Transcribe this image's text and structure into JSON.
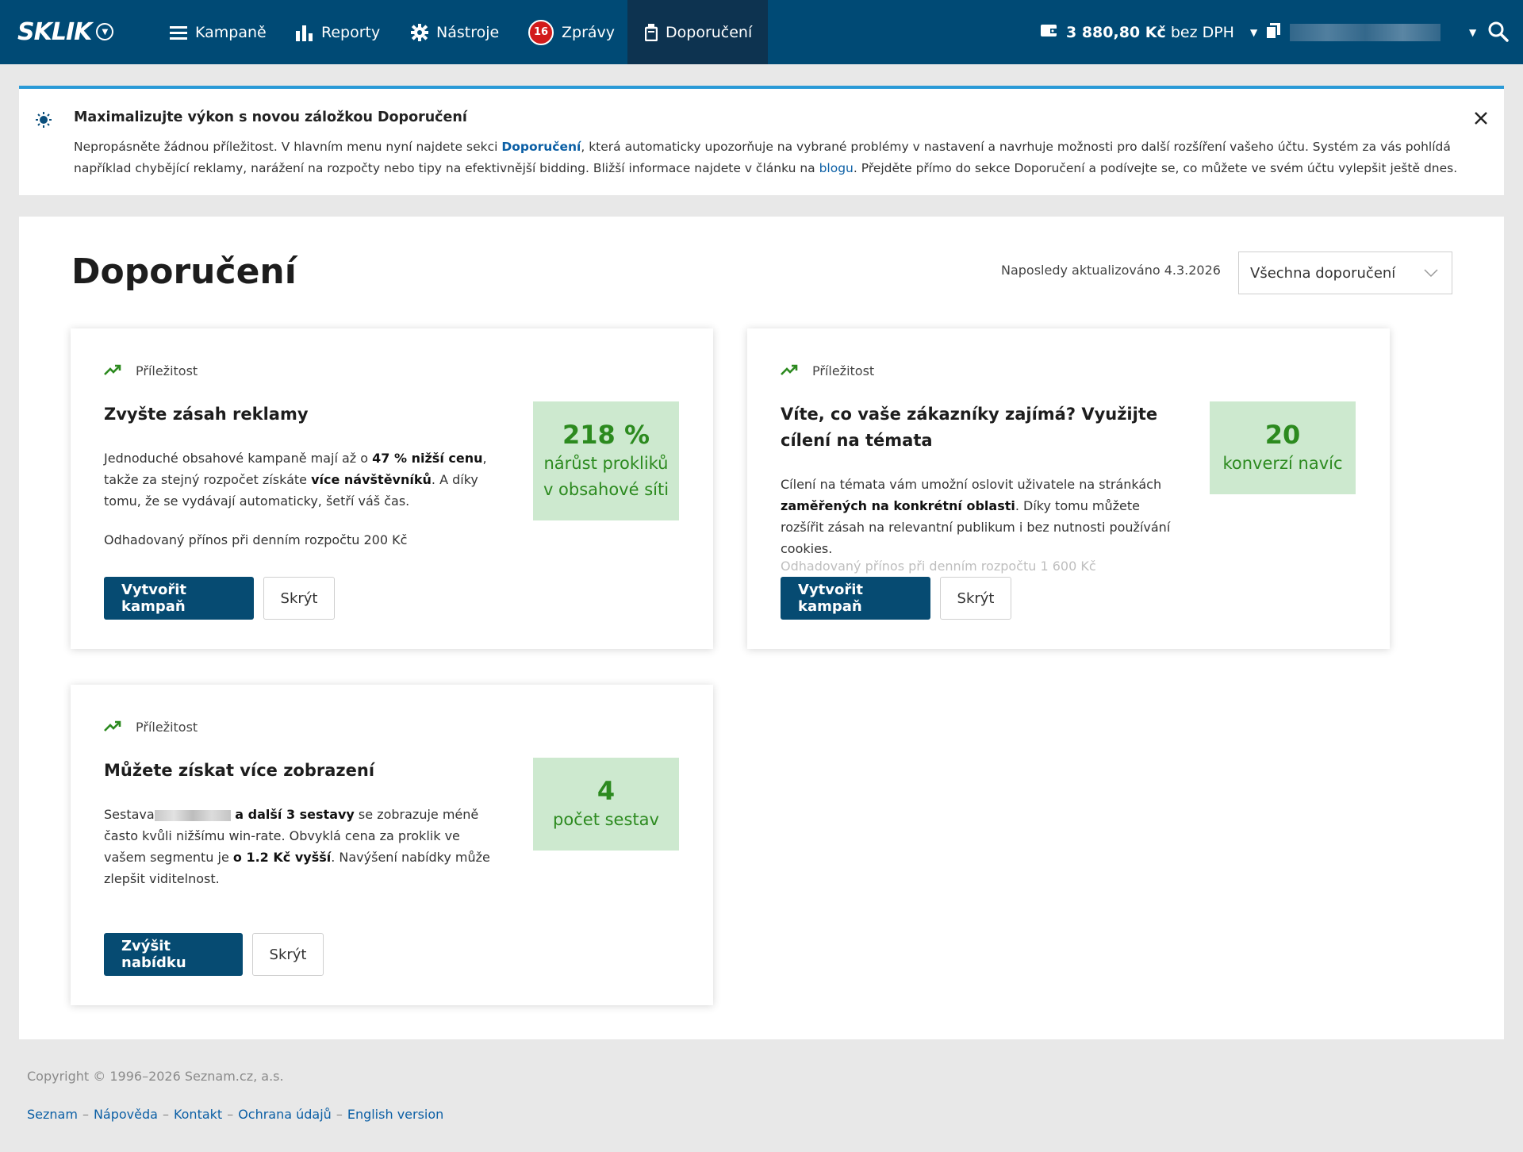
{
  "topbar": {
    "logo_text": "SKLIK",
    "nav": [
      {
        "label": "Kampaně",
        "icon": "menu-icon"
      },
      {
        "label": "Reporty",
        "icon": "bar-chart-icon"
      },
      {
        "label": "Nástroje",
        "icon": "gear-icon"
      },
      {
        "label": "Zprávy",
        "icon": "messages-badge",
        "badge": "16"
      },
      {
        "label": "Doporučení",
        "icon": "recommendation-icon",
        "active": true
      }
    ],
    "credit_amount": "3 880,80 Kč",
    "credit_suffix": "bez DPH",
    "colors": {
      "bar": "#004a75",
      "active": "#0d3350",
      "badge": "#d21b1b"
    }
  },
  "banner": {
    "title": "Maximalizujte výkon s novou záložkou Doporučení",
    "text_1": "Nepropásněte žádnou příležitost. V hlavním menu nyní najdete sekci ",
    "link_1": "Doporučení",
    "text_2": ", která automaticky upozorňuje na vybrané problémy v nastavení a navrhuje možnosti pro další rozšíření vašeho účtu. Systém za vás pohlídá například chybějící reklamy, narážení na rozpočty nebo tipy na efektivnější bidding. Bližší informace najdete v článku na ",
    "link_2": "blogu",
    "text_3": ". Přejděte přímo do sekce Doporučení a podívejte se, co můžete ve svém účtu vylepšit ještě dnes.",
    "accent": "#2a9ad7"
  },
  "main": {
    "title": "Doporučení",
    "updated": "Naposledy aktualizováno 4.3.2026",
    "filter_value": "Všechna doporučení"
  },
  "cards": [
    {
      "tag": "Příležitost",
      "title": "Zvyšte zásah reklamy",
      "desc": [
        {
          "t": "Jednoduché obsahové kampaně mají až o "
        },
        {
          "t": "47 % nižší cenu",
          "b": true
        },
        {
          "t": ", takže za stejný rozpočet získáte "
        },
        {
          "t": "více návštěvníků",
          "b": true
        },
        {
          "t": ". A díky tomu, že se vydávají automaticky, šetří váš čas."
        }
      ],
      "estimate": "Odhadovaný přínos při denním rozpočtu 200 Kč",
      "metric_value": "218 %",
      "metric_label": "nárůst prokliků v obsahové síti",
      "primary": "Vytvořit kampaň",
      "secondary": "Skrýt"
    },
    {
      "tag": "Příležitost",
      "title": "Víte, co vaše zákazníky zajímá? Využijte cílení na témata",
      "desc": [
        {
          "t": "Cílení na témata vám umožní oslovit uživatele na stránkách "
        },
        {
          "t": "zaměřených na konkrétní oblasti",
          "b": true
        },
        {
          "t": ". Díky tomu můžete rozšířit zásah na relevantní publikum i bez nutnosti používání cookies."
        }
      ],
      "estimate": "Odhadovaný přínos při denním rozpočtu 1 600 Kč",
      "metric_value": "20",
      "metric_label": "konverzí navíc",
      "primary": "Vytvořit kampaň",
      "secondary": "Skrýt"
    },
    {
      "tag": "Příležitost",
      "title": "Můžete získat více zobrazení",
      "desc": [
        {
          "t": "Sestava"
        },
        {
          "t": "",
          "blur": true
        },
        {
          "t": " a další 3 sestavy",
          "b": true
        },
        {
          "t": " se zobrazuje méně často kvůli nižšímu win-rate. Obvyklá cena za proklik ve vašem segmentu je "
        },
        {
          "t": "o 1.2 Kč vyšší",
          "b": true
        },
        {
          "t": ". Navýšení nabídky může zlepšit viditelnost."
        }
      ],
      "metric_value": "4",
      "metric_label": "počet sestav",
      "primary": "Zvýšit nabídku",
      "secondary": "Skrýt"
    }
  ],
  "metric_colors": {
    "bg": "#cde9cf",
    "text": "#2c8a1f"
  },
  "footer": {
    "copyright": "Copyright © 1996–2026 Seznam.cz, a.s.",
    "links": [
      "Seznam",
      "Nápověda",
      "Kontakt",
      "Ochrana údajů",
      "English version"
    ]
  }
}
